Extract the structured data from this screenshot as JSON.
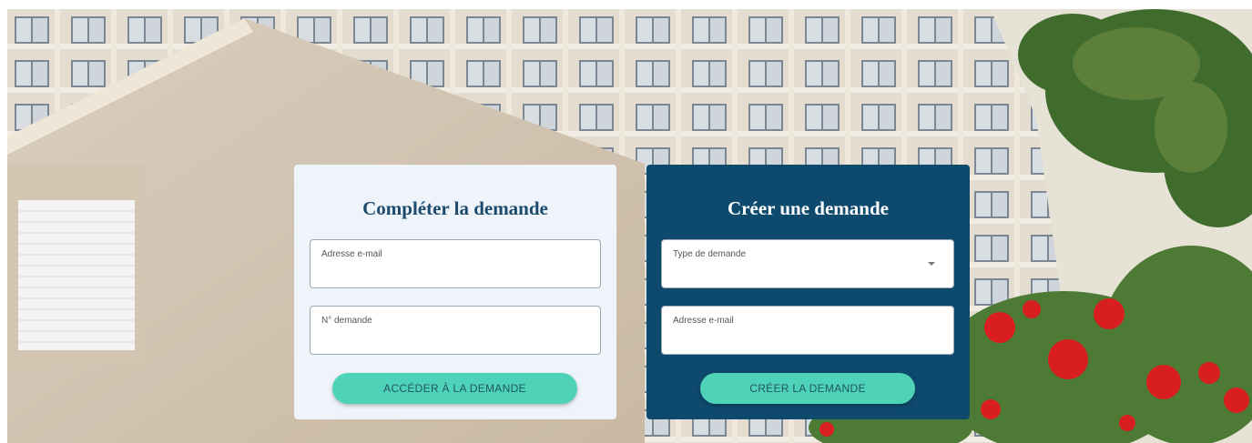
{
  "complete_form": {
    "title": "Compléter la demande",
    "email_label": "Adresse e-mail",
    "number_label": "N° demande",
    "submit_label": "ACCÉDER À LA DEMANDE"
  },
  "create_form": {
    "title": "Créer une demande",
    "type_label": "Type de demande",
    "email_label": "Adresse e-mail",
    "submit_label": "CRÉER LA DEMANDE"
  },
  "colors": {
    "light_card": "#eef4fa",
    "dark_card": "#0e4a6e",
    "accent_button": "#4fd3b8",
    "title_blue": "#1c4a6c"
  },
  "icons": {
    "select_arrow": "chevron-down-icon"
  }
}
